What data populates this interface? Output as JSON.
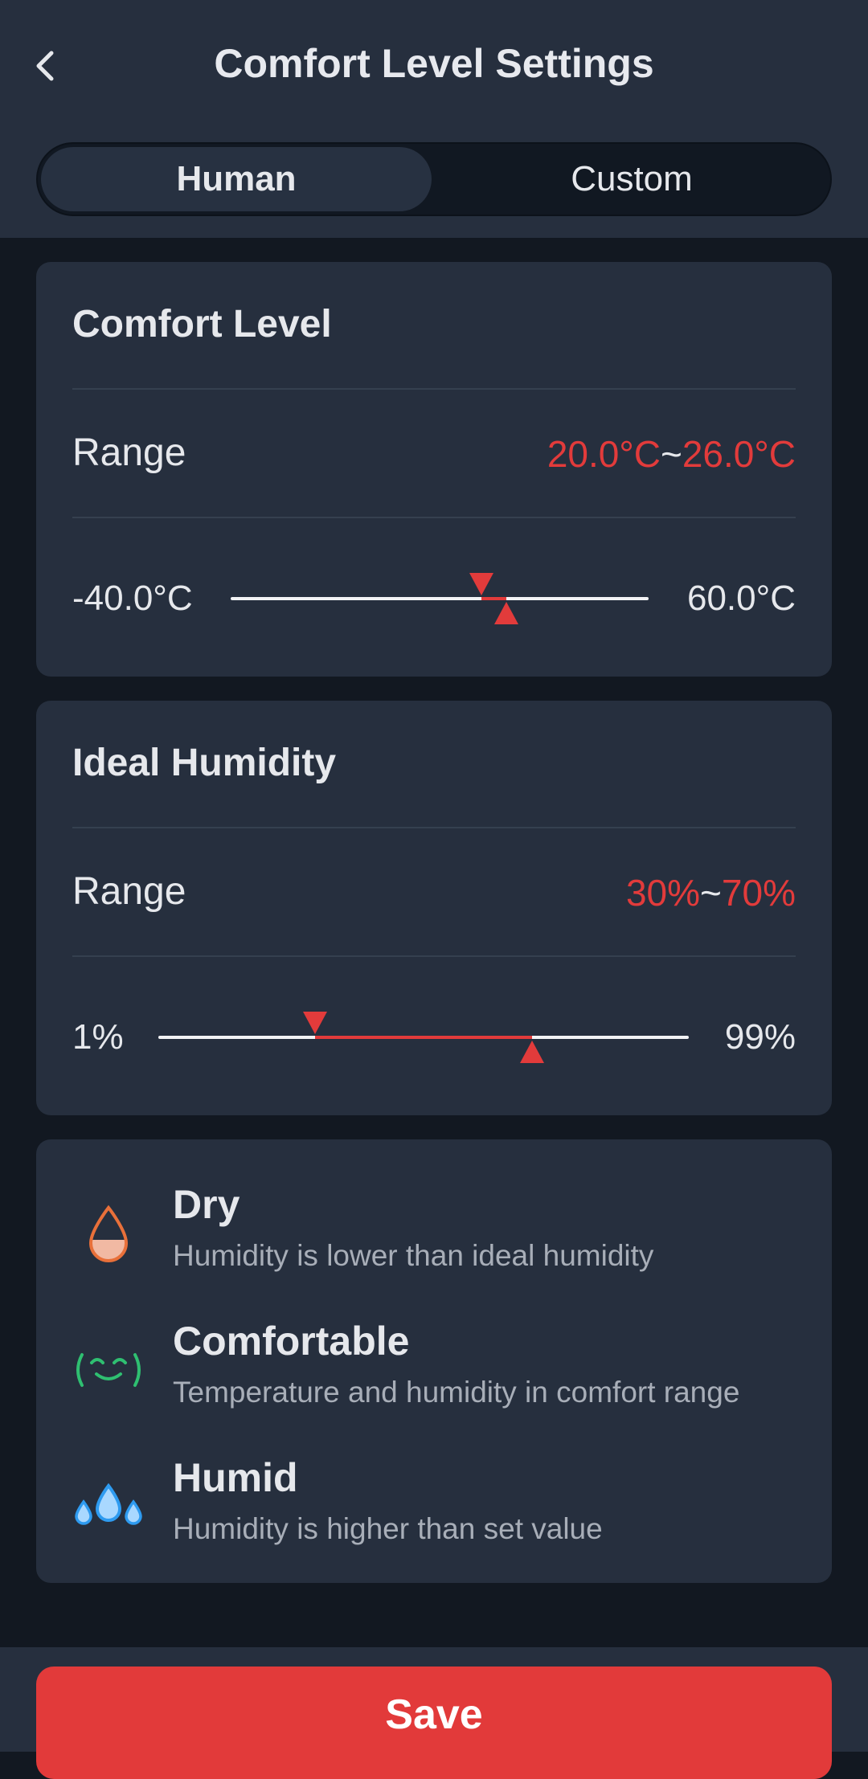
{
  "header": {
    "title": "Comfort Level Settings",
    "back_icon": "chevron-left-icon",
    "tabs": [
      {
        "label": "Human",
        "active": true
      },
      {
        "label": "Custom",
        "active": false
      }
    ]
  },
  "comfort": {
    "title": "Comfort Level",
    "range_label": "Range",
    "range_low": "20.0°C",
    "range_sep": "~",
    "range_high": "26.0°C",
    "min": "-40.0°C",
    "max": "60.0°C",
    "low_value": 20.0,
    "high_value": 26.0,
    "scale_min": -40.0,
    "scale_max": 60.0
  },
  "humidity": {
    "title": "Ideal Humidity",
    "range_label": "Range",
    "range_low": "30%",
    "range_sep": "~",
    "range_high": "70%",
    "min": "1%",
    "max": "99%",
    "low_value": 30,
    "high_value": 70,
    "scale_min": 1,
    "scale_max": 99
  },
  "legend": [
    {
      "icon": "water-drop-icon",
      "title": "Dry",
      "desc": "Humidity is lower than ideal humidity",
      "color": "#e8703a"
    },
    {
      "icon": "smile-face-icon",
      "title": "Comfortable",
      "desc": "Temperature and humidity in comfort range",
      "color": "#2fbf71"
    },
    {
      "icon": "humid-drops-icon",
      "title": "Humid",
      "desc": "Humidity is higher than set value",
      "color": "#2e9bf0"
    }
  ],
  "save_label": "Save",
  "colors": {
    "accent": "#e23b3b",
    "card": "#262f3e",
    "background": "#121821"
  }
}
